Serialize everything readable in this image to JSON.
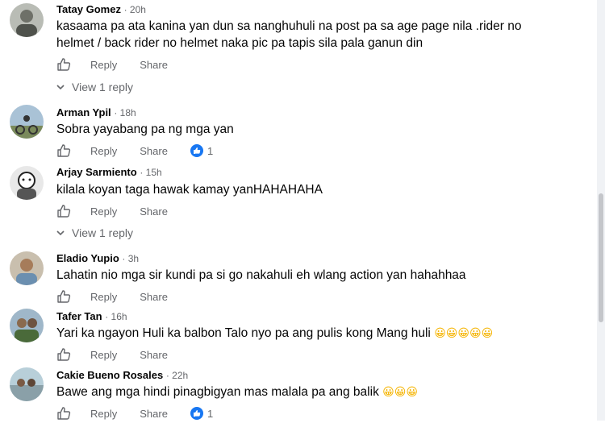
{
  "actions": {
    "reply": "Reply",
    "share": "Share"
  },
  "comments": [
    {
      "author": "Tatay Gomez",
      "time": "· 20h",
      "text": "kasaama pa ata kanina yan dun sa nanghuhuli na post pa sa age page nila .rider no helmet / back rider no helmet naka pic pa tapis sila pala ganun din",
      "view_replies": "View 1 reply"
    },
    {
      "author": "Arman Ypil",
      "time": "· 18h",
      "text": "Sobra yayabang pa ng mga yan",
      "reaction_count": "1"
    },
    {
      "author": "Arjay Sarmiento",
      "time": "· 15h",
      "text": "kilala koyan taga hawak kamay yanHAHAHAHA",
      "view_replies": "View 1 reply"
    },
    {
      "author": "Eladio Yupio",
      "time": "· 3h",
      "text": "Lahatin nio mga sir kundi pa si go nakahuli eh wlang action yan hahahhaa"
    },
    {
      "author": "Tafer Tan",
      "time": "· 16h",
      "text": "Yari ka ngayon Huli ka balbon Talo nyo pa ang pulis kong Mang huli",
      "emoji": "😀😀😀😀😀"
    },
    {
      "author": "Cakie Bueno Rosales",
      "time": "· 22h",
      "text": "Bawe ang mga hindi pinagbigyan mas malala pa ang balik",
      "emoji": "😀😀😀",
      "reaction_count": "1"
    }
  ],
  "colors": {
    "muted": "#65676b",
    "blue": "#1877f2"
  },
  "icons": {
    "like": "thumbs-up-icon",
    "chevron": "chevron-down-icon",
    "reaction": "like-reaction-icon"
  }
}
